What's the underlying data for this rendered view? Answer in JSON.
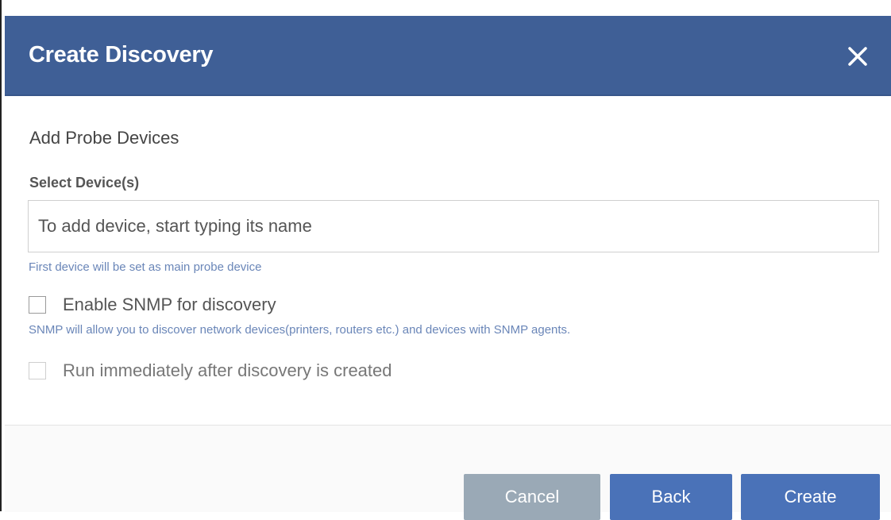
{
  "dialog": {
    "title": "Create Discovery"
  },
  "body": {
    "section_title": "Add Probe Devices",
    "select_devices_label": "Select Device(s)",
    "device_input": {
      "placeholder": "To add device, start typing its name",
      "value": ""
    },
    "device_hint": "First device will be set as main probe device",
    "snmp_checkbox": {
      "label": "Enable SNMP for discovery",
      "checked": false
    },
    "snmp_description": "SNMP will allow you to discover network devices(printers, routers etc.) and devices with SNMP agents.",
    "run_checkbox": {
      "label": "Run immediately after discovery is created",
      "checked": false
    }
  },
  "footer": {
    "cancel_label": "Cancel",
    "back_label": "Back",
    "create_label": "Create"
  },
  "colors": {
    "header_bg": "#3f5f96",
    "primary_button": "#4a72b8",
    "disabled_button": "#9aa9b6",
    "hint_text": "#6a86b8"
  },
  "icons": {
    "close": "close-icon"
  }
}
